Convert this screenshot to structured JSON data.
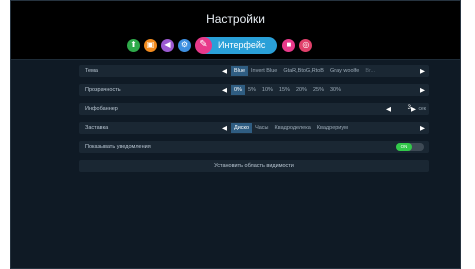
{
  "header": {
    "title": "Настройки",
    "active_tab_label": "Интерфейс",
    "tab_icons": [
      {
        "name": "network-icon",
        "color": "#2faa4a",
        "glyph": "⬆"
      },
      {
        "name": "media-icon",
        "color": "#f28b1e",
        "glyph": "▣"
      },
      {
        "name": "audio-icon",
        "color": "#9b59d0",
        "glyph": "◀"
      },
      {
        "name": "system-icon",
        "color": "#3d8fe0",
        "glyph": "⚙"
      },
      {
        "name": "interface-brush-icon",
        "color": "#e8398a",
        "glyph": "✎"
      },
      {
        "name": "lock-icon",
        "color": "#e8398a",
        "glyph": "🔒"
      },
      {
        "name": "info-icon",
        "color": "#e0406a",
        "glyph": "◎"
      }
    ]
  },
  "rows": {
    "theme": {
      "label": "Тема",
      "options": [
        "Blue",
        "Invert Blue",
        "GtaR,BtoG,RtoB",
        "Gray woolfe",
        "Br..."
      ],
      "selected": "Blue"
    },
    "transparency": {
      "label": "Прозрачность",
      "options": [
        "0%",
        "5%",
        "10%",
        "15%",
        "20%",
        "25%",
        "30%"
      ],
      "selected": "0%"
    },
    "infobanner": {
      "label": "Инфобаннер",
      "value": "3",
      "unit": "сек"
    },
    "screensaver": {
      "label": "Заставка",
      "options": [
        "Диско",
        "Часы",
        "Квадроделека",
        "Квадрериум"
      ],
      "selected": "Диско"
    },
    "notifications": {
      "label": "Показывать уведомления",
      "toggle_label": "ON",
      "enabled": true
    },
    "visible_area": {
      "label": "Установить область видимости"
    }
  },
  "colors": {
    "accent": "#2aa0d8",
    "selected_option": "#2f5d82",
    "toggle_on": "#32c94a"
  }
}
